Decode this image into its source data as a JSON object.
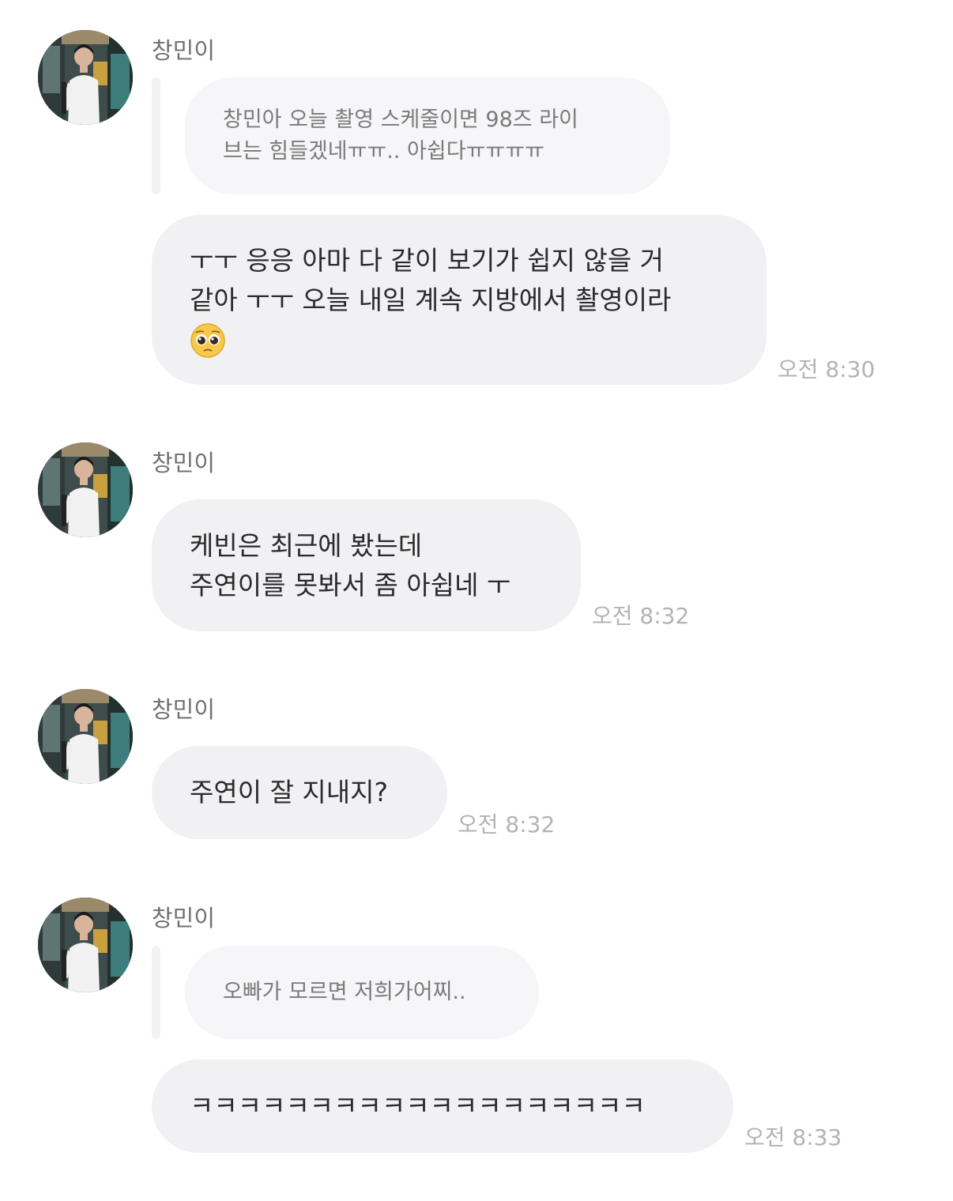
{
  "colors": {
    "bubble_bg": "#f1f1f4",
    "quote_bg": "#f6f6f8",
    "time_text": "#b3b3b3",
    "sender_text": "#6f6f6f"
  },
  "messages": [
    {
      "sender": "창민이",
      "quote_lines": [
        "창민아 오늘 촬영 스케줄이면 98즈 라이",
        "브는 힘들겠네ㅠㅠ.. 아쉽다ㅠㅠㅠㅠ"
      ],
      "reply_lines": [
        "ㅜㅜ 응응 아마 다 같이 보기가 쉽지 않을 거",
        "같아 ㅜㅜ 오늘 내일 계속 지방에서 촬영이라"
      ],
      "reply_emoji": "pleading-face-emoji",
      "time": "오전 8:30"
    },
    {
      "sender": "창민이",
      "reply_lines": [
        "케빈은 최근에 봤는데",
        "주연이를 못봐서 좀 아쉽네 ㅜ"
      ],
      "time": "오전 8:32"
    },
    {
      "sender": "창민이",
      "reply_lines": [
        "주연이 잘 지내지?"
      ],
      "time": "오전 8:32"
    },
    {
      "sender": "창민이",
      "quote_lines": [
        "오빠가 모르면 저희가어찌.."
      ],
      "reply_lines": [
        "ㅋㅋㅋㅋㅋㅋㅋㅋㅋㅋㅋㅋㅋㅋㅋㅋㅋㅋㅋ"
      ],
      "time": "오전 8:33"
    }
  ]
}
